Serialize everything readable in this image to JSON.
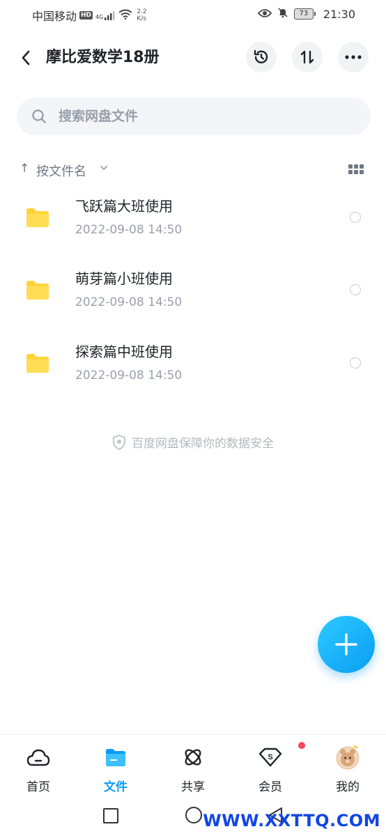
{
  "status_bar": {
    "carrier": "中国移动",
    "hd_badge": "HD",
    "net_type": "4G",
    "net_speed_value": "2.2",
    "net_speed_unit": "K/s",
    "battery": "73",
    "time": "21:30"
  },
  "header": {
    "title": "摩比爱数学18册"
  },
  "search": {
    "placeholder": "搜索网盘文件"
  },
  "sort": {
    "label": "按文件名"
  },
  "files": [
    {
      "name": "飞跃篇大班使用",
      "date": "2022-09-08  14:50"
    },
    {
      "name": "萌芽篇小班使用",
      "date": "2022-09-08  14:50"
    },
    {
      "name": "探索篇中班使用",
      "date": "2022-09-08  14:50"
    }
  ],
  "security_note": "百度网盘保障你的数据安全",
  "bottom_nav": {
    "items": [
      {
        "label": "首页",
        "icon": "cloud-home-icon"
      },
      {
        "label": "文件",
        "icon": "folder-icon"
      },
      {
        "label": "共享",
        "icon": "atom-share-icon"
      },
      {
        "label": "会员",
        "icon": "vip-diamond-icon"
      },
      {
        "label": "我的",
        "icon": "avatar"
      }
    ],
    "active_index": 1
  },
  "watermark": "WWW.XXTTQ.COM",
  "colors": {
    "accent": "#0a9cf5",
    "folder": "#ffd43b",
    "badge_red": "#f5475b"
  }
}
